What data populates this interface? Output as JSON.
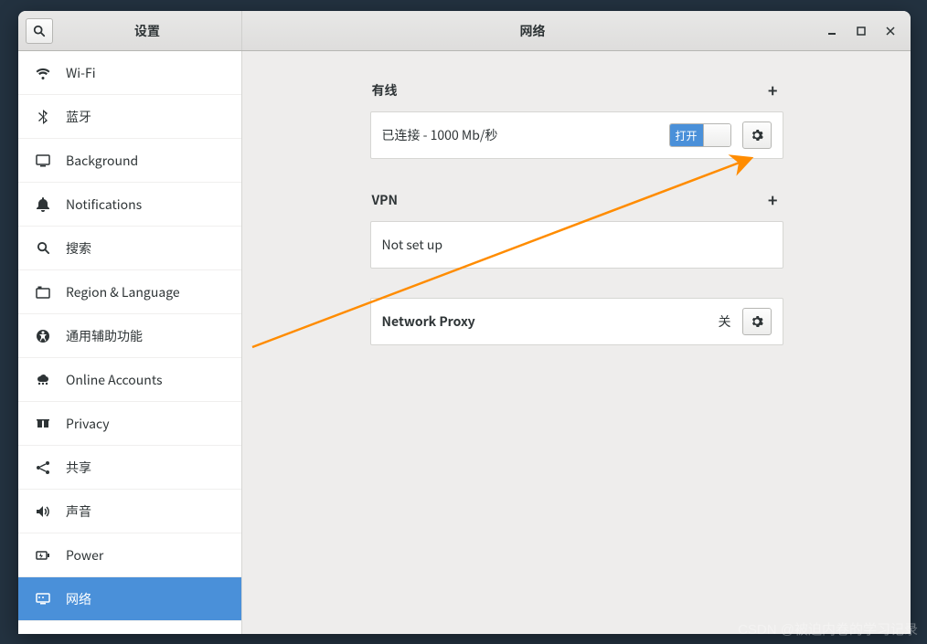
{
  "titlebar": {
    "left_title": "设置",
    "center_title": "网络"
  },
  "sidebar": {
    "items": [
      {
        "id": "wifi",
        "label": "Wi-Fi"
      },
      {
        "id": "bluetooth",
        "label": "蓝牙"
      },
      {
        "id": "background",
        "label": "Background"
      },
      {
        "id": "notifications",
        "label": "Notifications"
      },
      {
        "id": "search",
        "label": "搜索"
      },
      {
        "id": "region",
        "label": "Region & Language"
      },
      {
        "id": "accessibility",
        "label": "通用辅助功能"
      },
      {
        "id": "online-accounts",
        "label": "Online Accounts"
      },
      {
        "id": "privacy",
        "label": "Privacy"
      },
      {
        "id": "sharing",
        "label": "共享"
      },
      {
        "id": "sound",
        "label": "声音"
      },
      {
        "id": "power",
        "label": "Power"
      },
      {
        "id": "network",
        "label": "网络"
      }
    ],
    "selected": 12
  },
  "main": {
    "wired": {
      "heading": "有线",
      "status": "已连接 - 1000 Mb/秒",
      "toggle_on_label": "打开"
    },
    "vpn": {
      "heading": "VPN",
      "status": "Not set up"
    },
    "proxy": {
      "heading": "Network Proxy",
      "off_label": "关"
    }
  },
  "watermark": "CSDN @被迫内卷的学习记录"
}
